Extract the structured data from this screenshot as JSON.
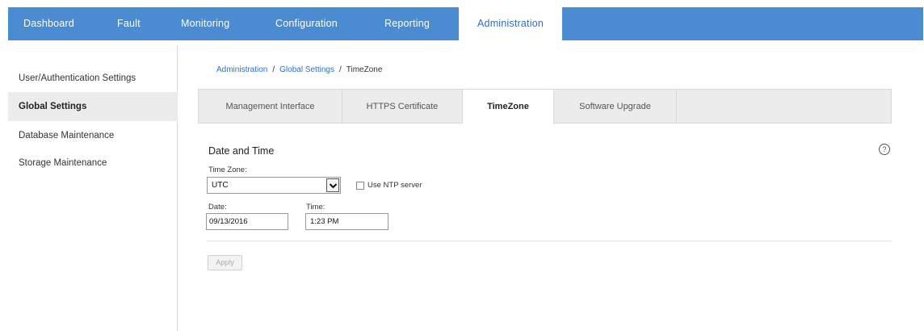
{
  "topnav": {
    "tabs": [
      {
        "label": "Dashboard"
      },
      {
        "label": "Fault"
      },
      {
        "label": "Monitoring"
      },
      {
        "label": "Configuration"
      },
      {
        "label": "Reporting"
      },
      {
        "label": "Administration"
      }
    ],
    "active_tab": "Administration",
    "bar_color": "#4a8bd2"
  },
  "sidebar": {
    "items": [
      {
        "label": "User/Authentication Settings"
      },
      {
        "label": "Global Settings"
      },
      {
        "label": "Database Maintenance"
      },
      {
        "label": "Storage Maintenance"
      }
    ],
    "active_item": "Global Settings"
  },
  "breadcrumb": {
    "items": [
      "Administration",
      "Global Settings",
      "TimeZone"
    ],
    "separator": "/"
  },
  "subtabs": {
    "items": [
      {
        "label": "Management Interface"
      },
      {
        "label": "HTTPS Certificate"
      },
      {
        "label": "TimeZone"
      },
      {
        "label": "Software Upgrade"
      }
    ],
    "active": "TimeZone"
  },
  "section": {
    "title": "Date and Time",
    "help_icon": "?"
  },
  "form": {
    "timezone_label": "Time Zone:",
    "timezone_value": "UTC",
    "ntp_label": "Use NTP server",
    "ntp_checked": false,
    "date_label": "Date:",
    "date_value": "09/13/2016",
    "time_label": "Time:",
    "time_value": "1:23 PM",
    "apply_label": "Apply"
  }
}
